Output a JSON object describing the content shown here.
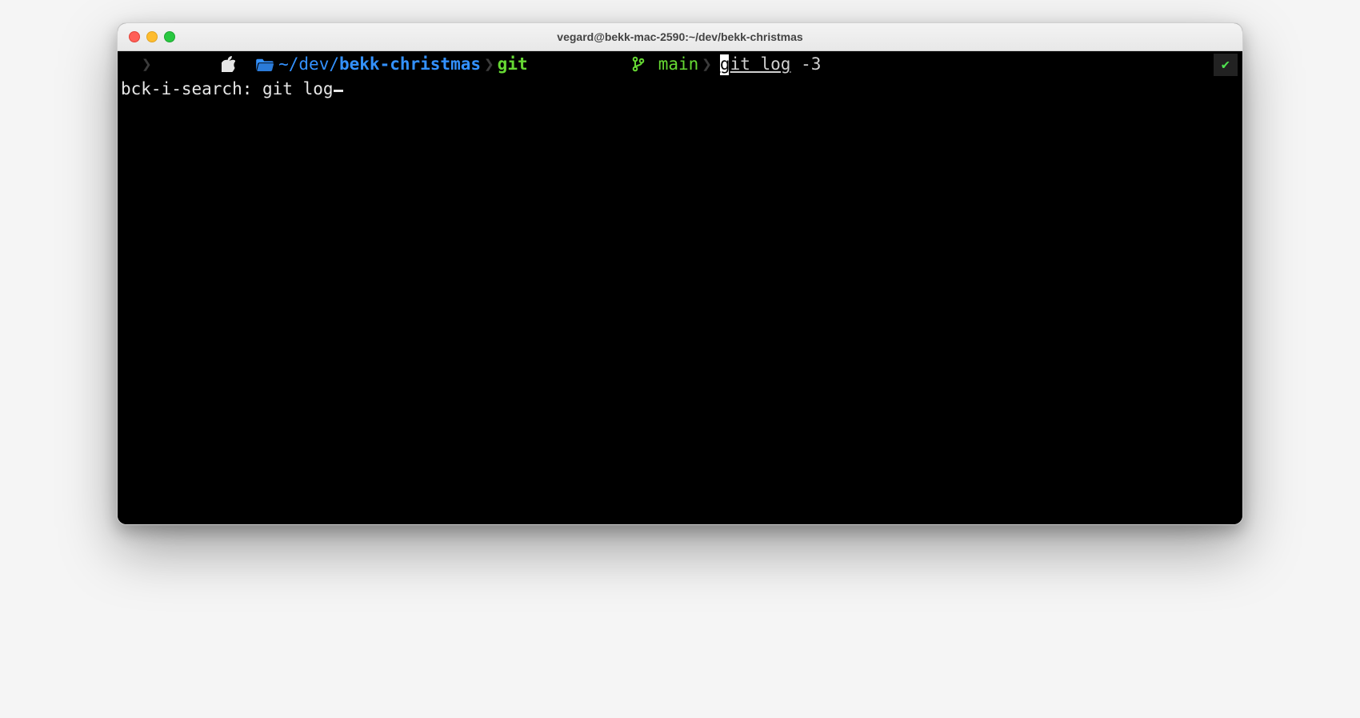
{
  "window": {
    "title": "vegard@bekk-mac-2590:~/dev/bekk-christmas"
  },
  "prompt": {
    "path_prefix": "~",
    "path_mid": "dev",
    "path_repo": "bekk-christmas",
    "git_label": "git",
    "branch": " main",
    "sep": "❯"
  },
  "command": {
    "first_char": "g",
    "matched_rest": "it ",
    "matched_word2": "log",
    "unmatched": " -3"
  },
  "search": {
    "prefix": "bck-i-search: ",
    "query": "git log"
  },
  "status": {
    "check": "✔"
  }
}
